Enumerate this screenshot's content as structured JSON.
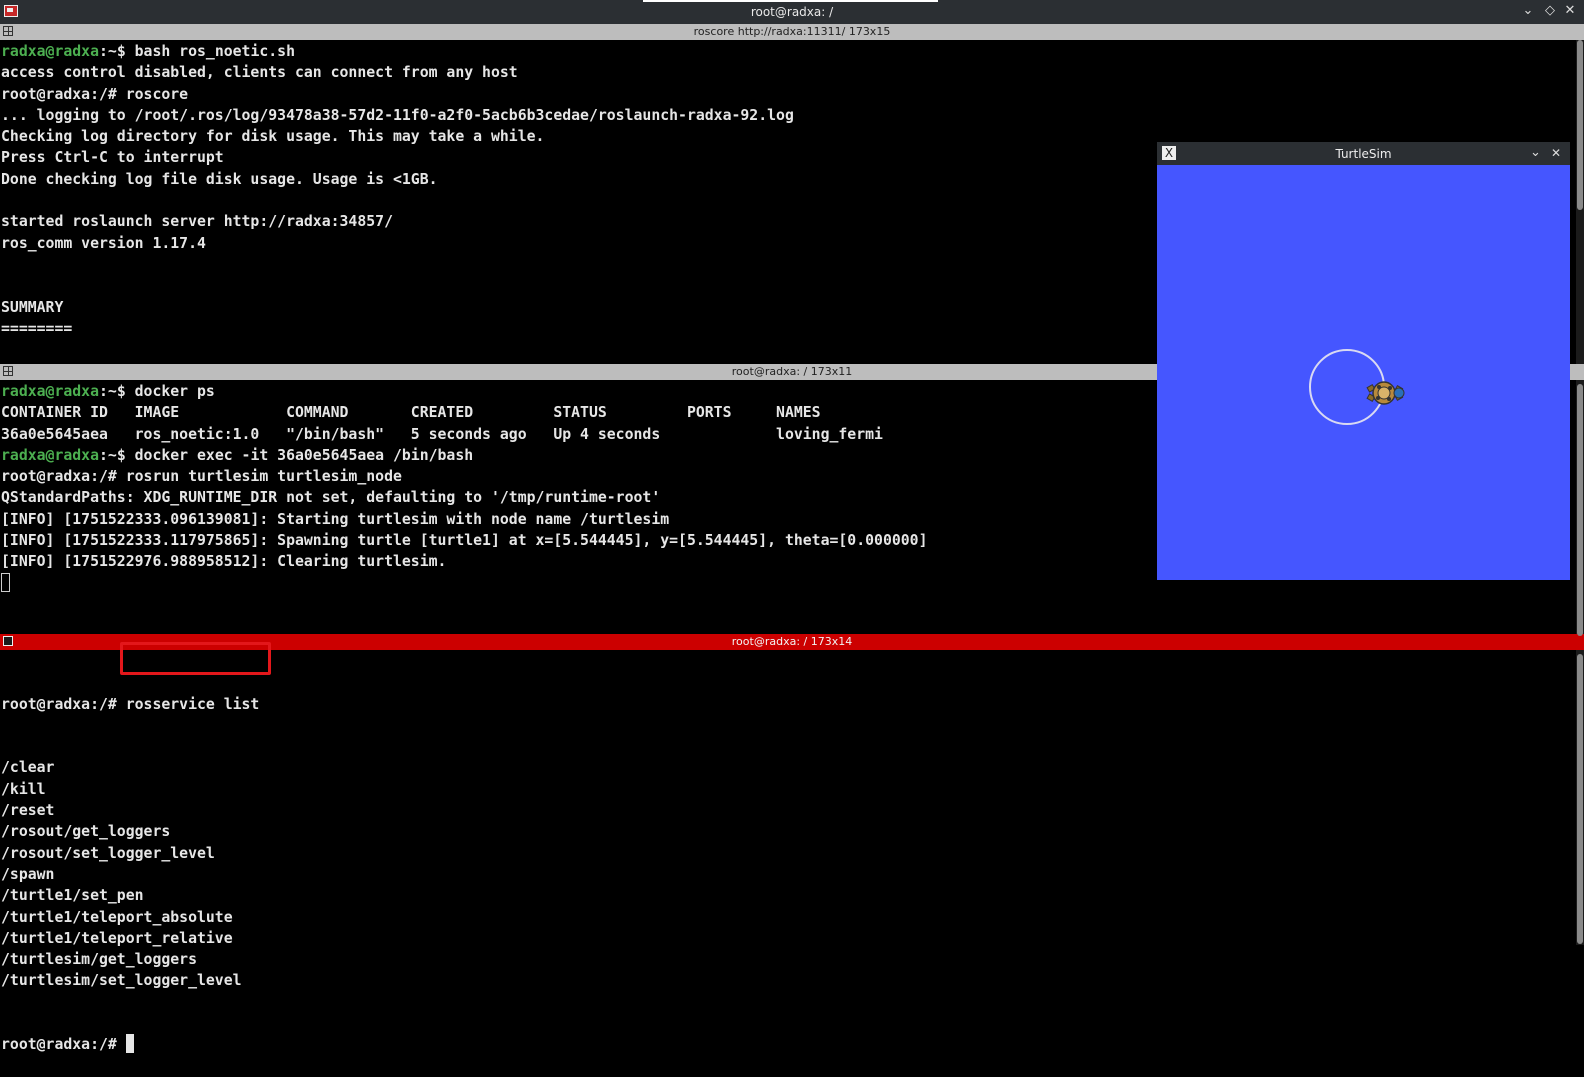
{
  "window": {
    "title": "root@radxa: /",
    "minimize_icon": "chevron-down-icon",
    "maximize_icon": "diamond-icon",
    "close_icon": "close-icon"
  },
  "panes": [
    {
      "header": "roscore http://radxa:11311/ 173x15",
      "lines": [
        {
          "prompt": "radxa@radxa",
          "promptRest": ":~$ ",
          "text": "bash ros_noetic.sh"
        },
        {
          "text": "access control disabled, clients can connect from any host"
        },
        {
          "text": "root@radxa:/# roscore"
        },
        {
          "text": "... logging to /root/.ros/log/93478a38-57d2-11f0-a2f0-5acb6b3cedae/roslaunch-radxa-92.log"
        },
        {
          "text": "Checking log directory for disk usage. This may take a while."
        },
        {
          "text": "Press Ctrl-C to interrupt"
        },
        {
          "text": "Done checking log file disk usage. Usage is <1GB."
        },
        {
          "text": ""
        },
        {
          "text": "started roslaunch server http://radxa:34857/"
        },
        {
          "text": "ros_comm version 1.17.4"
        },
        {
          "text": ""
        },
        {
          "text": ""
        },
        {
          "text": "SUMMARY"
        },
        {
          "text": "========"
        }
      ]
    },
    {
      "header": "root@radxa: / 173x11",
      "lines": [
        {
          "prompt": "radxa@radxa",
          "promptRest": ":~$ ",
          "text": "docker ps"
        },
        {
          "text": "CONTAINER ID   IMAGE            COMMAND       CREATED         STATUS         PORTS     NAMES"
        },
        {
          "text": "36a0e5645aea   ros_noetic:1.0   \"/bin/bash\"   5 seconds ago   Up 4 seconds             loving_fermi"
        },
        {
          "prompt": "radxa@radxa",
          "promptRest": ":~$ ",
          "text": "docker exec -it 36a0e5645aea /bin/bash"
        },
        {
          "text": "root@radxa:/# rosrun turtlesim turtlesim_node"
        },
        {
          "text": "QStandardPaths: XDG_RUNTIME_DIR not set, defaulting to '/tmp/runtime-root'"
        },
        {
          "text": "[INFO] [1751522333.096139081]: Starting turtlesim with node name /turtlesim"
        },
        {
          "text": "[INFO] [1751522333.117975865]: Spawning turtle [turtle1] at x=[5.544445], y=[5.544445], theta=[0.000000]"
        },
        {
          "text": "[INFO] [1751522976.988958512]: Clearing turtlesim."
        }
      ]
    },
    {
      "header": "root@radxa: / 173x14",
      "command_prompt": "root@radxa:/# ",
      "command": "rosservice list",
      "lines": [
        {
          "text": "/clear"
        },
        {
          "text": "/kill"
        },
        {
          "text": "/reset"
        },
        {
          "text": "/rosout/get_loggers"
        },
        {
          "text": "/rosout/set_logger_level"
        },
        {
          "text": "/spawn"
        },
        {
          "text": "/turtle1/set_pen"
        },
        {
          "text": "/turtle1/teleport_absolute"
        },
        {
          "text": "/turtle1/teleport_relative"
        },
        {
          "text": "/turtlesim/get_loggers"
        },
        {
          "text": "/turtlesim/set_logger_level"
        }
      ],
      "final_prompt": "root@radxa:/# "
    }
  ],
  "turtlesim": {
    "title": "TurtleSim",
    "background": "#4556ff",
    "pen_color": "#d9d9f2",
    "icon": "x11-icon"
  },
  "colors": {
    "prompt_user": "#4caf50",
    "active_header": "#cc0000",
    "highlight_box": "#e3171b"
  }
}
